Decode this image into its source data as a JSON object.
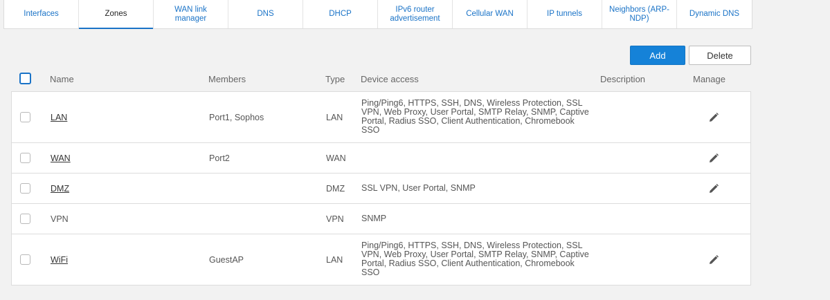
{
  "tabs": [
    {
      "label": "Interfaces",
      "active": false
    },
    {
      "label": "Zones",
      "active": true
    },
    {
      "label": "WAN link manager",
      "active": false
    },
    {
      "label": "DNS",
      "active": false
    },
    {
      "label": "DHCP",
      "active": false
    },
    {
      "label": "IPv6 router advertisement",
      "active": false
    },
    {
      "label": "Cellular WAN",
      "active": false
    },
    {
      "label": "IP tunnels",
      "active": false
    },
    {
      "label": "Neighbors (ARP-NDP)",
      "active": false
    },
    {
      "label": "Dynamic DNS",
      "active": false
    }
  ],
  "toolbar": {
    "add_label": "Add",
    "delete_label": "Delete"
  },
  "table": {
    "headers": {
      "name": "Name",
      "members": "Members",
      "type": "Type",
      "device_access": "Device access",
      "description": "Description",
      "manage": "Manage"
    },
    "rows": [
      {
        "name": "LAN",
        "link": true,
        "members": "Port1, Sophos",
        "type": "LAN",
        "access": "Ping/Ping6, HTTPS, SSH, DNS, Wireless Protection, SSL VPN, Web Proxy, User Portal, SMTP Relay, SNMP, Captive Portal, Radius SSO, Client Authentication, Chromebook SSO",
        "description": "",
        "editable": true
      },
      {
        "name": "WAN",
        "link": true,
        "members": "Port2",
        "type": "WAN",
        "access": "",
        "description": "",
        "editable": true
      },
      {
        "name": "DMZ",
        "link": true,
        "members": "",
        "type": "DMZ",
        "access": "SSL VPN, User Portal, SNMP",
        "description": "",
        "editable": true
      },
      {
        "name": "VPN",
        "link": false,
        "members": "",
        "type": "VPN",
        "access": "SNMP",
        "description": "",
        "editable": false
      },
      {
        "name": "WiFi",
        "link": true,
        "members": "GuestAP",
        "type": "LAN",
        "access": "Ping/Ping6, HTTPS, SSH, DNS, Wireless Protection, SSL VPN, Web Proxy, User Portal, SMTP Relay, SNMP, Captive Portal, Radius SSO, Client Authentication, Chromebook SSO",
        "description": "",
        "editable": true
      }
    ]
  },
  "icons": {
    "edit": "pencil-icon"
  },
  "colors": {
    "accent": "#1a73c7",
    "add_button": "#1582d8",
    "background": "#f2f2f2"
  }
}
